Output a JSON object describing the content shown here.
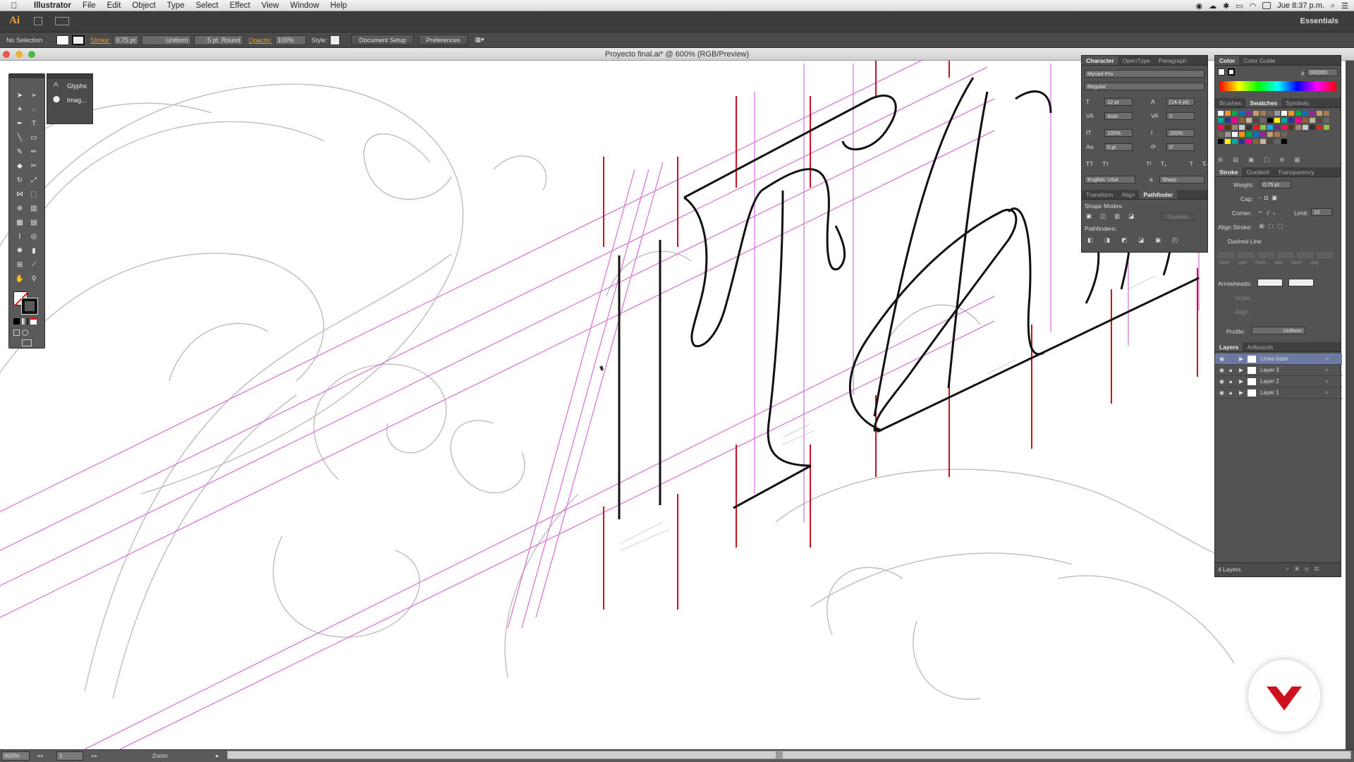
{
  "menubar": {
    "app_name": "Illustrator",
    "items": [
      "File",
      "Edit",
      "Object",
      "Type",
      "Select",
      "Effect",
      "View",
      "Window",
      "Help"
    ],
    "clock": "Jue 8:37 p.m."
  },
  "appbar": {
    "logo": "Ai",
    "workspace": "Essentials"
  },
  "control": {
    "selection": "No Selection",
    "stroke_label": "Stroke:",
    "stroke_weight": "0.75 pt",
    "profile": "Uniform",
    "brush": "5 pt. Round",
    "opacity_label": "Opacity:",
    "opacity": "100%",
    "style_label": "Style:",
    "document_setup": "Document Setup",
    "preferences": "Preferences"
  },
  "document": {
    "title": "Proyecto final.ai* @ 600% (RGB/Preview)"
  },
  "side_panel": {
    "glyphs": "Glyphs",
    "image": "Imag..."
  },
  "character_panel": {
    "tabs": [
      "Character",
      "OpenType",
      "Paragraph"
    ],
    "font": "Myriad Pro",
    "style": "Regular",
    "size": "12 pt",
    "leading": "(14.4 pt)",
    "kerning": "Auto",
    "tracking": "0",
    "vscale": "100%",
    "hscale": "100%",
    "baseline": "0 pt",
    "rotation": "0°",
    "language": "English: USA",
    "antialias": "Sharp",
    "aa_label": "a"
  },
  "pathfinder_panel": {
    "tabs": [
      "Transform",
      "Align",
      "Pathfinder"
    ],
    "shape_modes": "Shape Modes:",
    "expand": "Expand",
    "pathfinders": "Pathfinders:"
  },
  "color_panel": {
    "tabs": [
      "Color",
      "Color Guide"
    ],
    "hex": "000000",
    "hash": "#"
  },
  "swatch_panel": {
    "tabs": [
      "Brushes",
      "Swatches",
      "Symbols"
    ]
  },
  "stroke_panel": {
    "tabs": [
      "Stroke",
      "Gradient",
      "Transparency"
    ],
    "weight_label": "Weight:",
    "weight": "0.75 pt",
    "cap_label": "Cap:",
    "corner_label": "Corner:",
    "limit_label": "Limit:",
    "limit": "10",
    "align_label": "Align Stroke:",
    "dashed": "Dashed Line",
    "dash_labels": [
      "dash",
      "gap",
      "dash",
      "gap",
      "dash",
      "gap"
    ],
    "arrowheads": "Arrowheads:",
    "scale": "Scale:",
    "align2": "Align:",
    "profile_label": "Profile:",
    "profile": "Uniform"
  },
  "layers_panel": {
    "tabs": [
      "Layers",
      "Artboards"
    ],
    "layers": [
      "Línea base",
      "Layer 3",
      "Layer 2",
      "Layer 1"
    ],
    "count": "4 Layers"
  },
  "status": {
    "zoom": "600%",
    "page": "1",
    "tool": "Zoom"
  },
  "colors": {
    "guide_magenta": "#d77ad7",
    "guide_red": "#cc1020",
    "sketch_gray": "#b8b8b8",
    "ink": "#111111",
    "brand_red": "#d0101c"
  }
}
